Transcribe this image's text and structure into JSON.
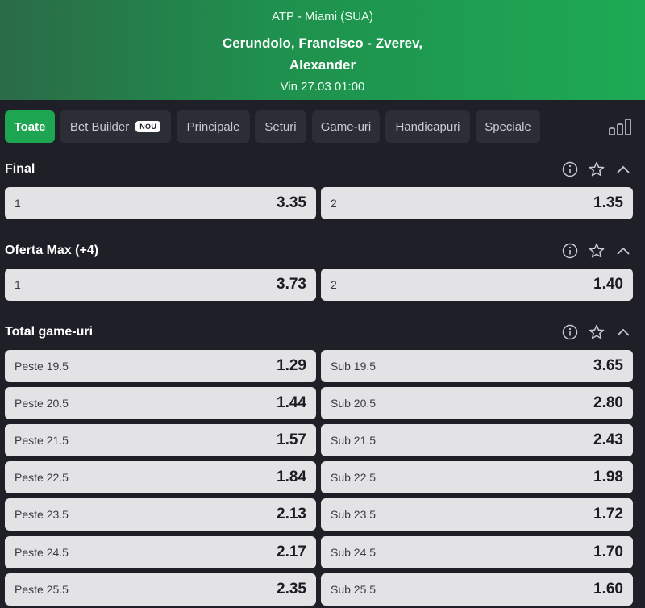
{
  "header": {
    "league": "ATP - Miami (SUA)",
    "match": "Cerundolo, Francisco - Zverev, Alexander",
    "date": "Vin 27.03 01:00"
  },
  "tabs": [
    {
      "label": "Toate",
      "active": true
    },
    {
      "label": "Bet Builder",
      "badge": "NOU"
    },
    {
      "label": "Principale"
    },
    {
      "label": "Seturi"
    },
    {
      "label": "Game-uri"
    },
    {
      "label": "Handicapuri"
    },
    {
      "label": "Speciale"
    }
  ],
  "sections": [
    {
      "title": "Final",
      "odds": [
        [
          {
            "label": "1",
            "value": "3.35"
          },
          {
            "label": "2",
            "value": "1.35"
          }
        ]
      ]
    },
    {
      "title": "Oferta Max (+4)",
      "odds": [
        [
          {
            "label": "1",
            "value": "3.73"
          },
          {
            "label": "2",
            "value": "1.40"
          }
        ]
      ]
    },
    {
      "title": "Total game-uri",
      "odds": [
        [
          {
            "label": "Peste 19.5",
            "value": "1.29"
          },
          {
            "label": "Sub 19.5",
            "value": "3.65"
          }
        ],
        [
          {
            "label": "Peste 20.5",
            "value": "1.44"
          },
          {
            "label": "Sub 20.5",
            "value": "2.80"
          }
        ],
        [
          {
            "label": "Peste 21.5",
            "value": "1.57"
          },
          {
            "label": "Sub 21.5",
            "value": "2.43"
          }
        ],
        [
          {
            "label": "Peste 22.5",
            "value": "1.84"
          },
          {
            "label": "Sub 22.5",
            "value": "1.98"
          }
        ],
        [
          {
            "label": "Peste 23.5",
            "value": "2.13"
          },
          {
            "label": "Sub 23.5",
            "value": "1.72"
          }
        ],
        [
          {
            "label": "Peste 24.5",
            "value": "2.17"
          },
          {
            "label": "Sub 24.5",
            "value": "1.70"
          }
        ],
        [
          {
            "label": "Peste 25.5",
            "value": "2.35"
          },
          {
            "label": "Sub 25.5",
            "value": "1.60"
          }
        ]
      ]
    }
  ],
  "colors": {
    "accent": "#1ea552",
    "background": "#1f2027",
    "odd_bg": "#e3e3e6"
  }
}
